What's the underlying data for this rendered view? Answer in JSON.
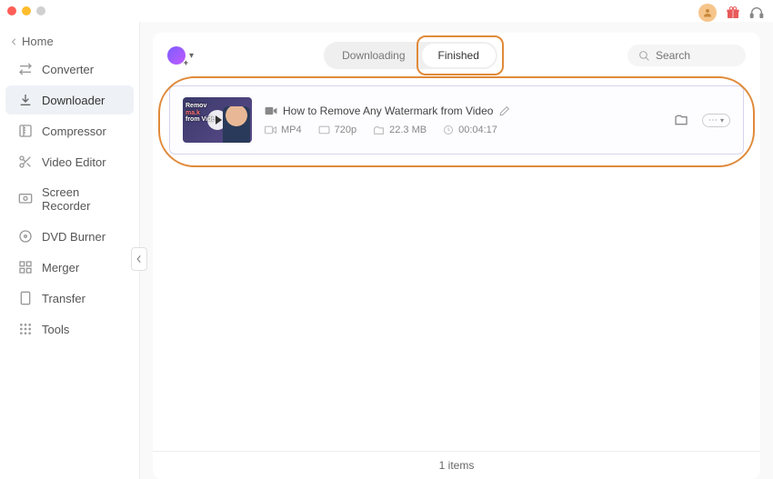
{
  "sidebar": {
    "home": "Home",
    "items": [
      {
        "label": "Converter"
      },
      {
        "label": "Downloader"
      },
      {
        "label": "Compressor"
      },
      {
        "label": "Video Editor"
      },
      {
        "label": "Screen Recorder"
      },
      {
        "label": "DVD Burner"
      },
      {
        "label": "Merger"
      },
      {
        "label": "Transfer"
      },
      {
        "label": "Tools"
      }
    ]
  },
  "tabs": {
    "downloading": "Downloading",
    "finished": "Finished"
  },
  "search": {
    "placeholder": "Search"
  },
  "item": {
    "title": "How to Remove Any Watermark from Video",
    "format": "MP4",
    "resolution": "720p",
    "size": "22.3 MB",
    "duration": "00:04:17",
    "thumb_line1": "Remov",
    "thumb_line2": "from Vide"
  },
  "footer": {
    "count": "1 items"
  }
}
